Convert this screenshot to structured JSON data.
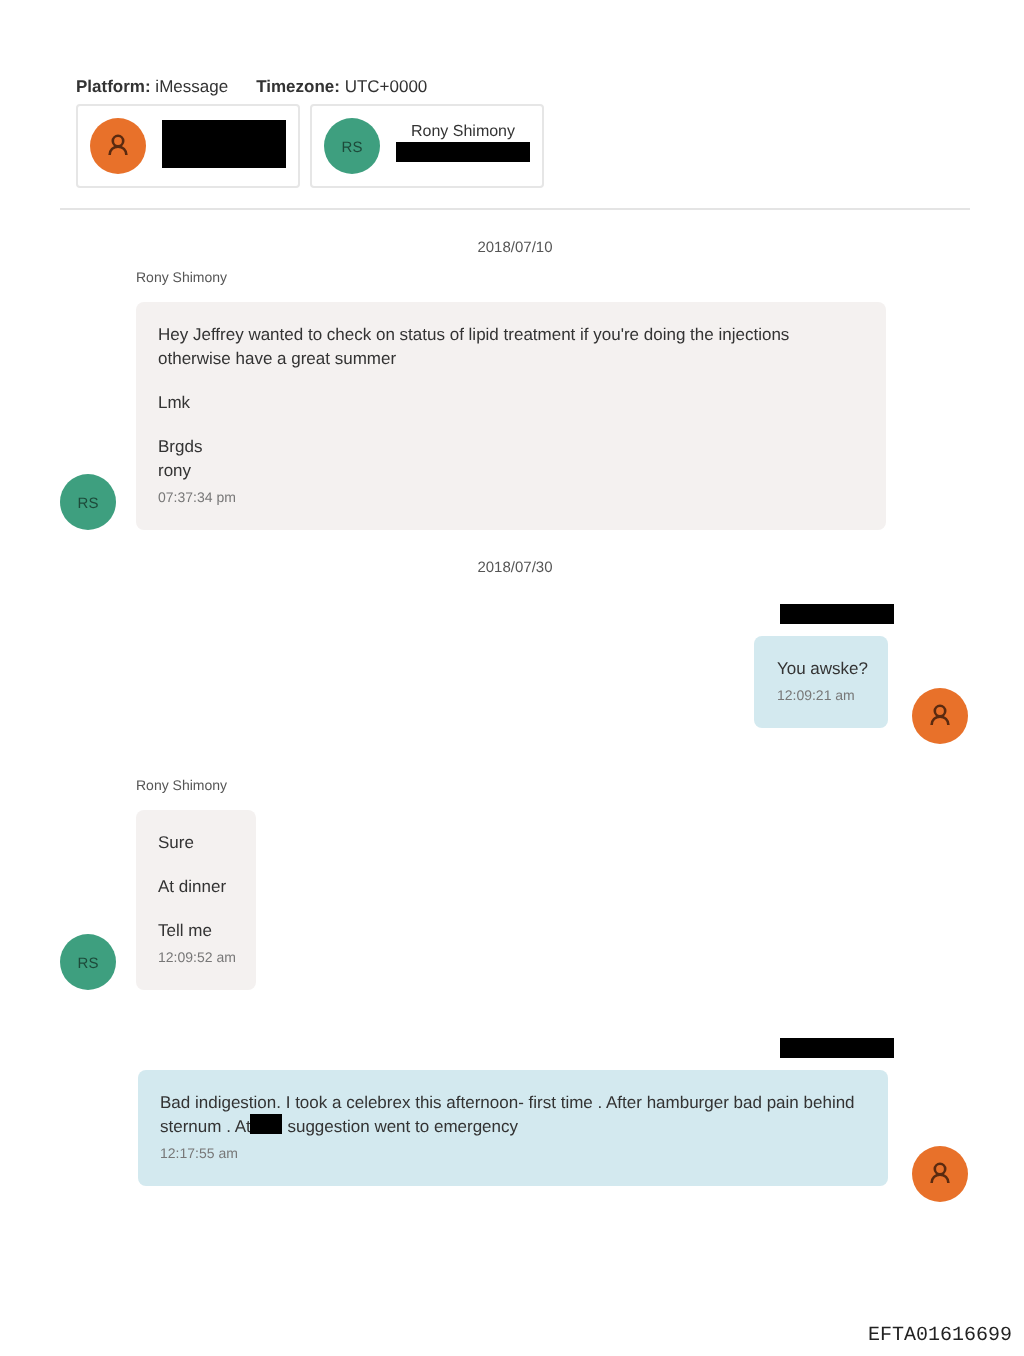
{
  "header": {
    "platform": "**Platform:** iMessage",
    "timezone": "**Timezone:** UTC+0000"
  },
  "participants": [
    {
      "avatar": {
        "kind": "person",
        "color": "#e8712a"
      },
      "name_redacted": true
    },
    {
      "avatar": {
        "kind": "initials",
        "initials": "RS",
        "color": "#3e9f7f"
      },
      "name": "Rony Shimony",
      "detail_redacted": true
    }
  ],
  "conversation": [
    {
      "kind": "date",
      "text": "2018/07/10"
    },
    {
      "kind": "incoming",
      "sender": "Rony Shimony",
      "avatar": {
        "kind": "initials",
        "initials": "RS",
        "color": "#3e9f7f"
      },
      "paragraphs": [
        "Hey Jeffrey wanted to check on status of lipid treatment if you're doing the injections otherwise have a great summer",
        "Lmk",
        "Brgds\nrony"
      ],
      "time": "07:37:34 pm"
    },
    {
      "kind": "date",
      "text": "2018/07/30"
    },
    {
      "kind": "outgoing",
      "sender_redacted": true,
      "avatar": {
        "kind": "person",
        "color": "#e8712a"
      },
      "paragraphs": [
        "You awske?"
      ],
      "time": "12:09:21 am"
    },
    {
      "kind": "incoming",
      "sender": "Rony Shimony",
      "avatar": {
        "kind": "initials",
        "initials": "RS",
        "color": "#3e9f7f"
      },
      "paragraphs": [
        "Sure",
        "At dinner",
        "Tell me"
      ],
      "time": "12:09:52 am"
    },
    {
      "kind": "outgoing",
      "sender_redacted": true,
      "avatar": {
        "kind": "person",
        "color": "#e8712a"
      },
      "paragraphs": [
        [
          {
            "kind": "text",
            "text": "Bad indigestion. I took a celebrex this afternoon- first time . After hamburger bad pain behind sternum . At"
          },
          {
            "kind": "redaction"
          },
          {
            "kind": "text",
            "text": " suggestion went to emergency"
          }
        ]
      ],
      "time": "12:17:55 am"
    }
  ],
  "stamp": "EFTA01616699"
}
